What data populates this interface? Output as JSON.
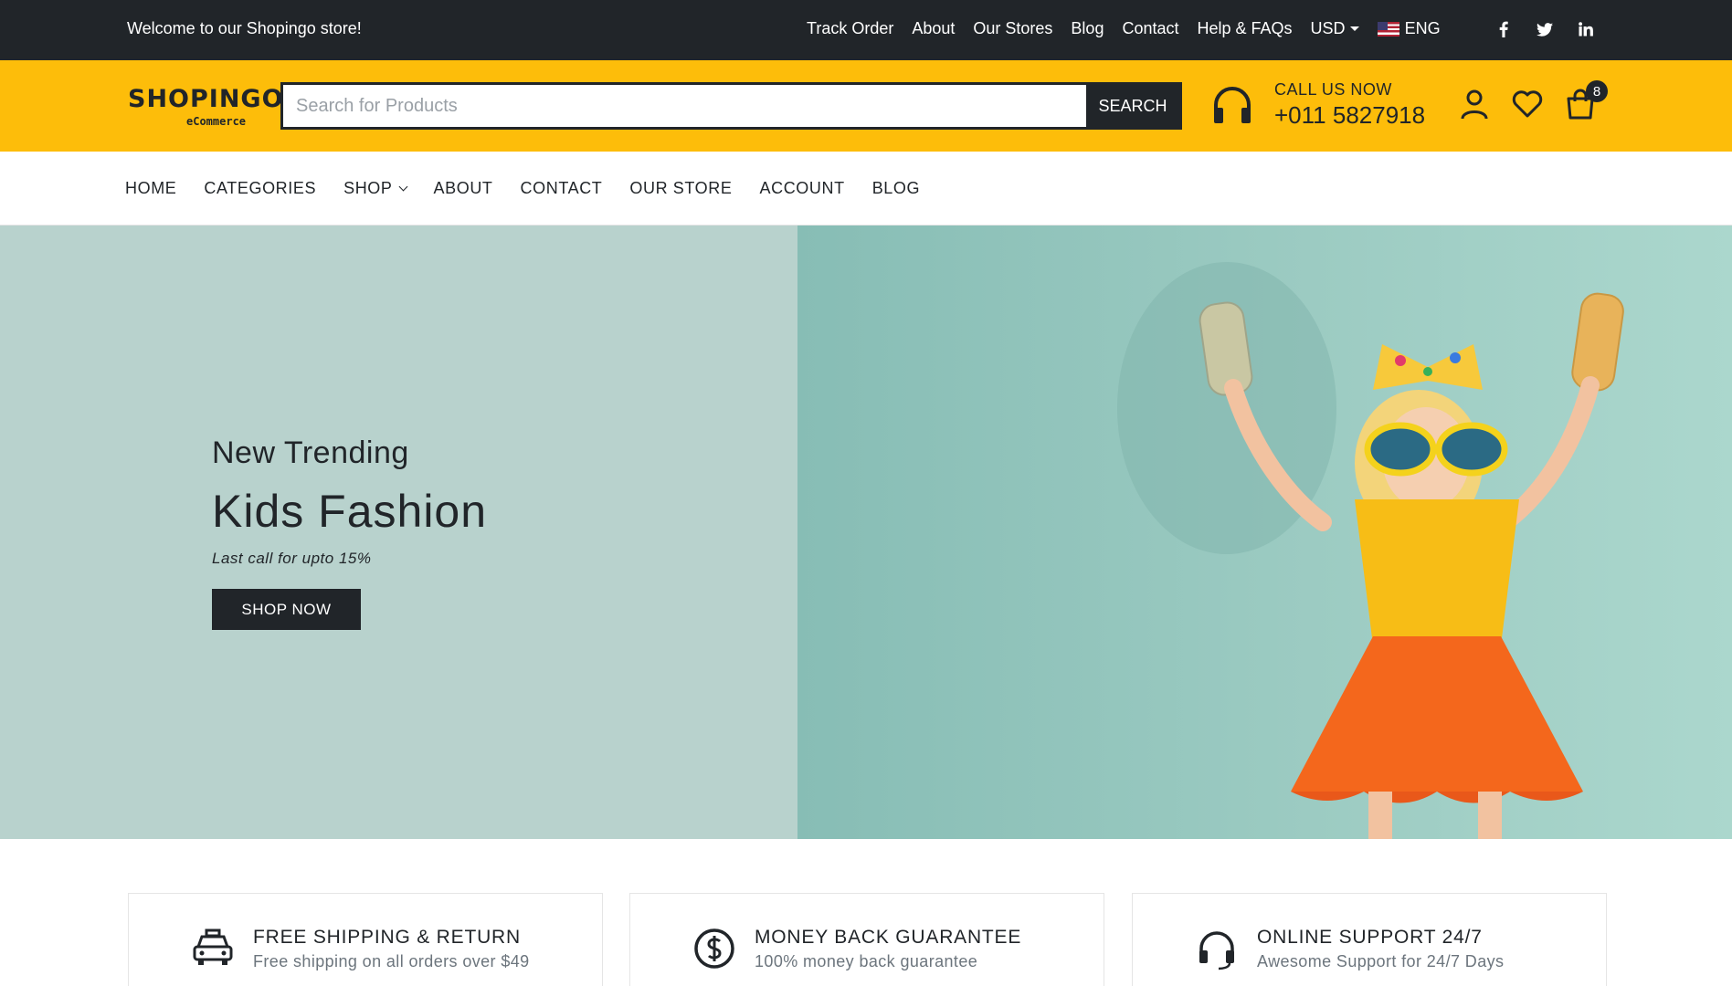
{
  "topbar": {
    "welcome": "Welcome to our Shopingo store!",
    "links": [
      "Track Order",
      "About",
      "Our Stores",
      "Blog",
      "Contact",
      "Help & FAQs"
    ],
    "currency": "USD",
    "language": "ENG",
    "social_icons": [
      "facebook-icon",
      "twitter-icon",
      "linkedin-icon"
    ]
  },
  "header": {
    "logo_brand": "SHOPINGO",
    "logo_sub": "eCommerce",
    "search_placeholder": "Search for Products",
    "search_button": "SEARCH",
    "call_label": "CALL US NOW",
    "call_phone": "+011 5827918",
    "cart_count": "8"
  },
  "nav": {
    "items": [
      "HOME",
      "CATEGORIES",
      "SHOP",
      "ABOUT",
      "CONTACT",
      "OUR STORE",
      "ACCOUNT",
      "BLOG"
    ]
  },
  "hero": {
    "subtitle": "New Trending",
    "title": "Kids Fashion",
    "tagline": "Last call for upto 15%",
    "cta": "SHOP NOW"
  },
  "features": [
    {
      "title": "FREE SHIPPING & RETURN",
      "desc": "Free shipping on all orders over $49",
      "icon": "taxi-icon"
    },
    {
      "title": "MONEY BACK GUARANTEE",
      "desc": "100% money back guarantee",
      "icon": "dollar-circle-icon"
    },
    {
      "title": "ONLINE SUPPORT 24/7",
      "desc": "Awesome Support for 24/7 Days",
      "icon": "headphones-icon"
    }
  ],
  "colors": {
    "topbar_bg": "#212529",
    "accent_yellow": "#fdbd0a",
    "hero_left_bg": "#b8d2cd",
    "hero_right_bg": "#9ccbc2"
  }
}
